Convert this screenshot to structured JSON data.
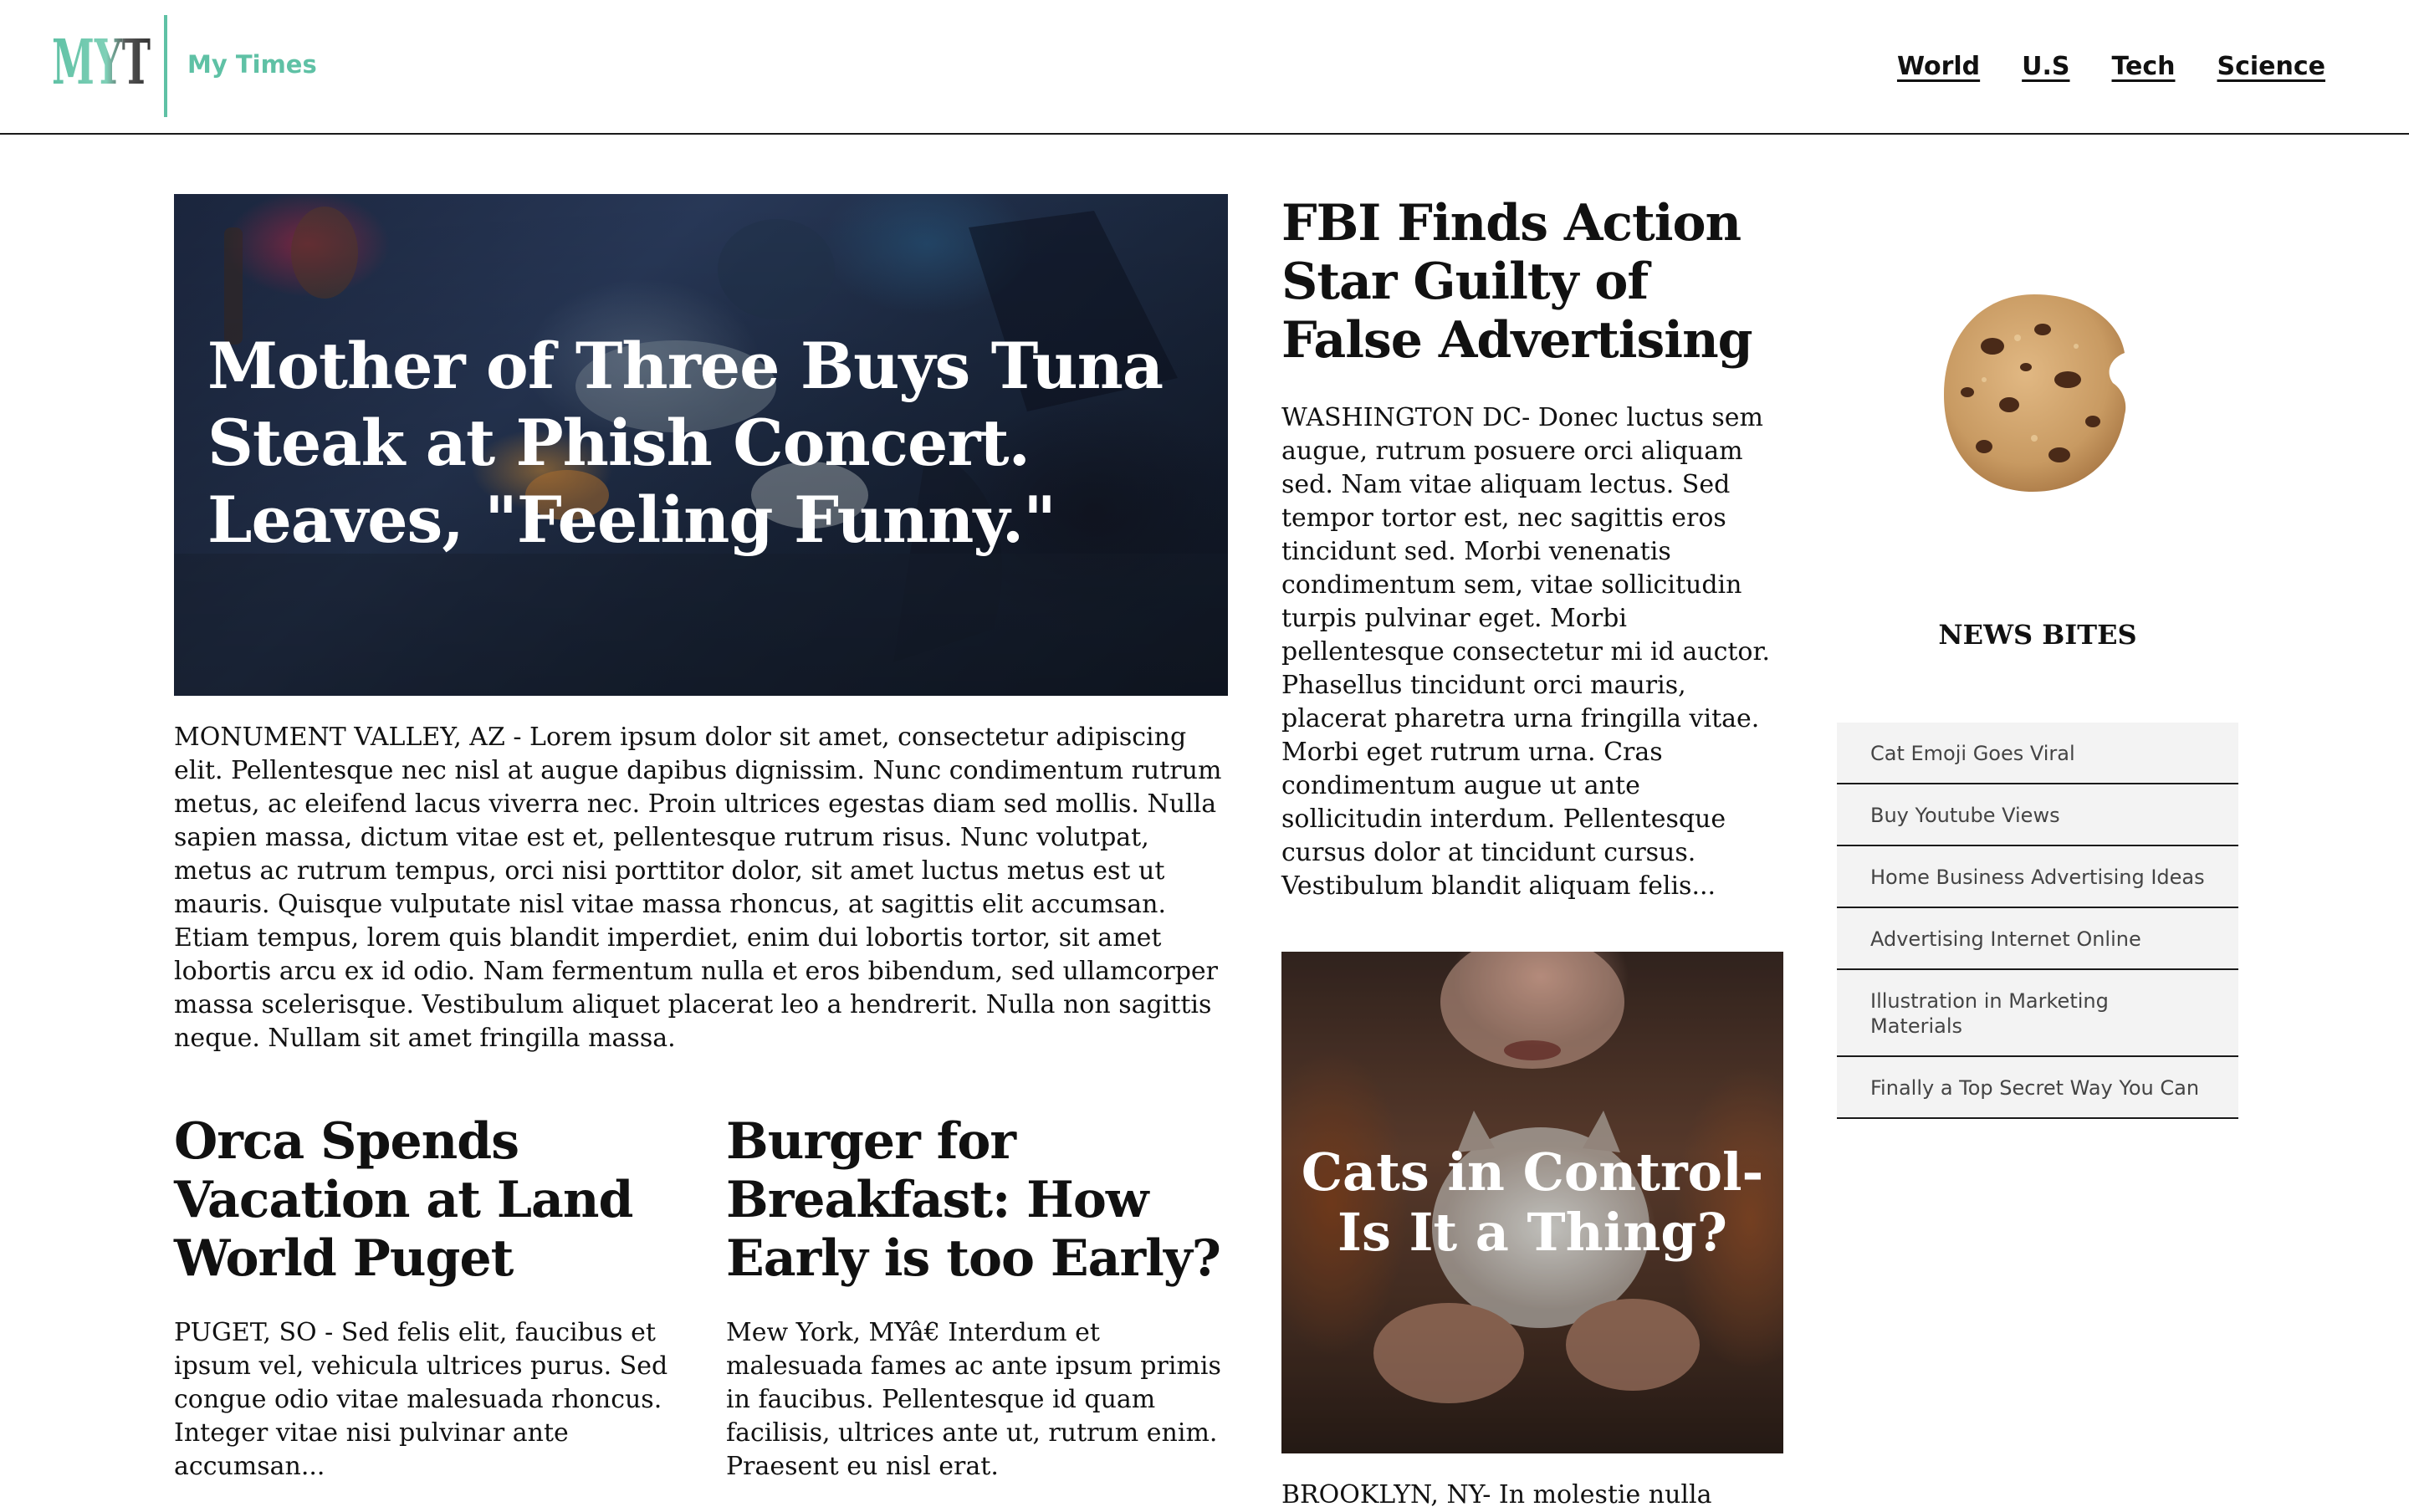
{
  "header": {
    "logo_text": "MYT",
    "site_name": "My Times",
    "nav": [
      "World",
      "U.S",
      "Tech",
      "Science"
    ]
  },
  "hero": {
    "title": "Mother of Three Buys Tuna Steak at Phish Concert. Leaves, \"Feeling Funny.\"",
    "body": "MONUMENT VALLEY, AZ - Lorem ipsum dolor sit amet, consectetur adipiscing elit. Pellentesque nec nisl at augue dapibus dignissim. Nunc condimentum rutrum metus, ac eleifend lacus viverra nec. Proin ultrices egestas diam sed mollis. Nulla sapien massa, dictum vitae est et, pellentesque rutrum risus. Nunc volutpat, metus ac rutrum tempus, orci nisi porttitor dolor, sit amet luctus metus est ut mauris. Quisque vulputate nisl vitae massa rhoncus, at sagittis elit accumsan. Etiam tempus, lorem quis blandit imperdiet, enim dui lobortis tortor, sit amet lobortis arcu ex id odio. Nam fermentum nulla et eros bibendum, sed ullamcorper massa scelerisque. Vestibulum aliquet placerat leo a hendrerit. Nulla non sagittis neque. Nullam sit amet fringilla massa."
  },
  "articles": {
    "orca": {
      "title": "Orca Spends Vacation at Land World Puget",
      "body": "PUGET, SO - Sed felis elit, faucibus et ipsum vel, vehicula ultrices purus. Sed congue odio vitae malesuada rhoncus. Integer vitae nisi pulvinar ante accumsan..."
    },
    "burger": {
      "title": "Burger for Breakfast: How Early is too Early?",
      "body": "Mew York, MYâ€    Interdum et malesuada fames ac ante ipsum primis in faucibus. Pellentesque id quam facilisis, ultrices ante ut, rutrum enim. Praesent eu nisl erat."
    },
    "fbi": {
      "title": "FBI Finds Action Star Guilty of False Advertising",
      "body": "WASHINGTON DC- Donec luctus sem augue, rutrum posuere orci aliquam sed. Nam vitae aliquam lectus. Sed tempor tortor est, nec sagittis eros tincidunt sed. Morbi venenatis condimentum sem, vitae sollicitudin turpis pulvinar eget. Morbi pellentesque consectetur mi id auctor. Phasellus tincidunt orci mauris, placerat pharetra urna fringilla vitae. Morbi eget rutrum urna. Cras condimentum augue ut ante sollicitudin interdum. Pellentesque cursus dolor at tincidunt cursus. Vestibulum blandit aliquam felis..."
    },
    "cats": {
      "title": "Cats in Control-Is It a Thing?",
      "body": "BROOKLYN, NY- In molestie nulla"
    }
  },
  "news_bites": {
    "title": "NEWS BITES",
    "items": [
      "Cat Emoji Goes Viral",
      "Buy Youtube Views",
      "Home Business Advertising Ideas",
      "Advertising Internet Online",
      "Illustration in Marketing Materials",
      "Finally a Top Secret Way You Can"
    ]
  },
  "colors": {
    "accent": "#5fc1a5",
    "text": "#111111",
    "bite_background": "#f3f3f3"
  },
  "icons": {
    "logo": "myt-logo",
    "sidebar_image": "cookie-image"
  }
}
